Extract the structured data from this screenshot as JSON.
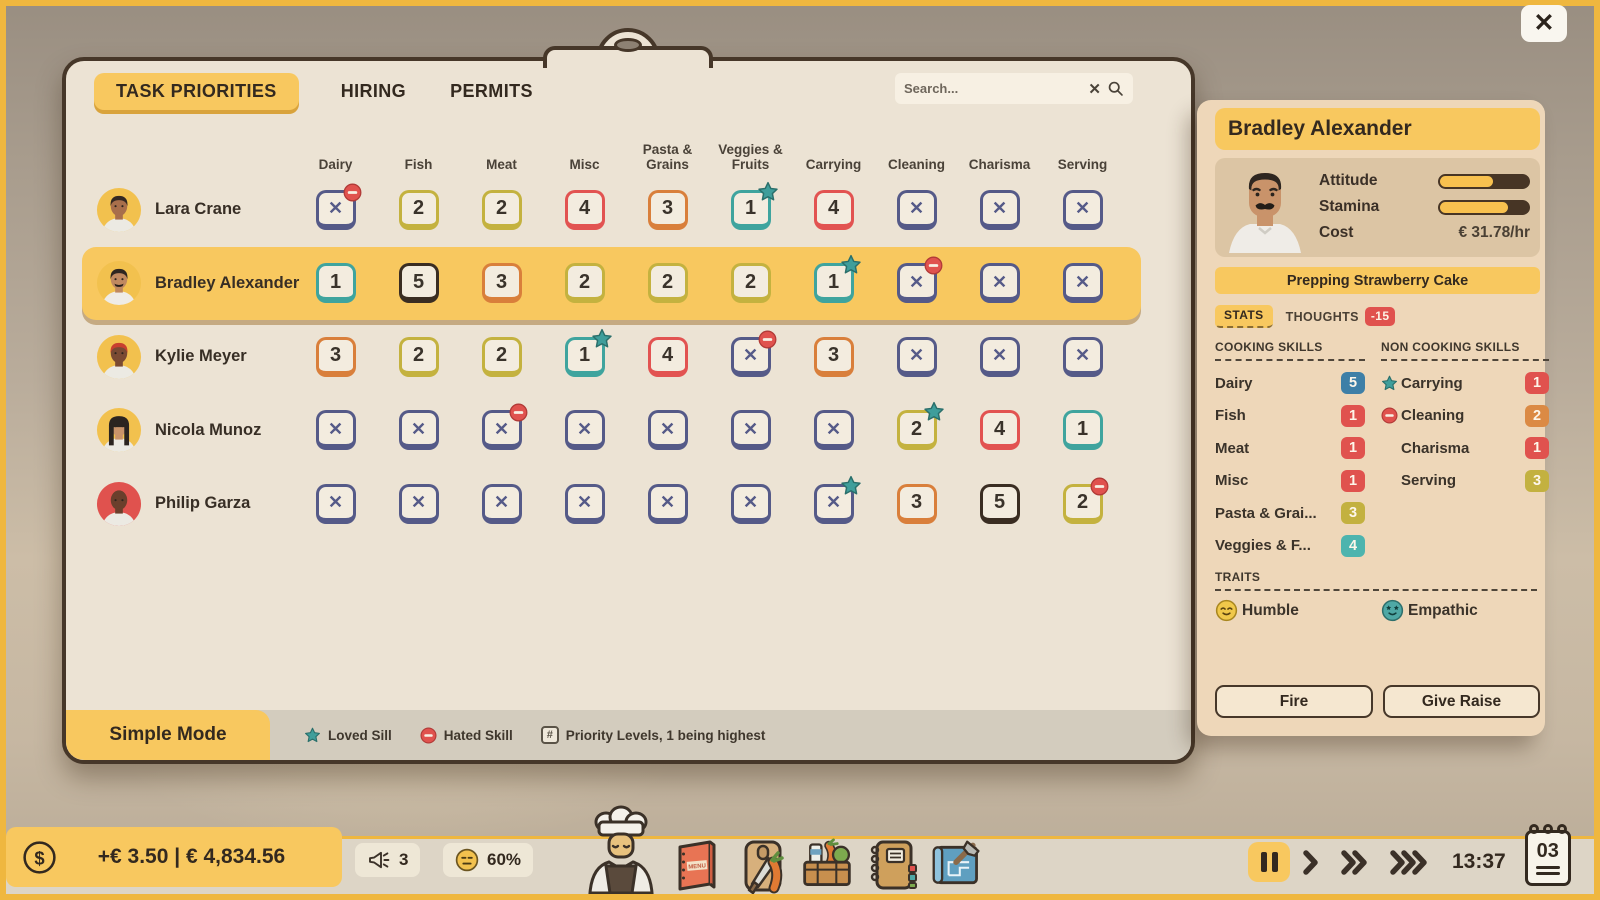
{
  "colors": {
    "accent_yellow": "#f8c85f",
    "panel_bg": "#ece3d4",
    "panel_border": "#463729",
    "detail_bg": "#eed7b9",
    "hud_bg": "#ddd5c6",
    "frame": "#efb73f",
    "loved_teal": "#3f9e9b",
    "hated_red": "#e0524e"
  },
  "window": {
    "close_icon": "✕"
  },
  "tabs": [
    {
      "label": "TASK PRIORITIES",
      "active": true
    },
    {
      "label": "HIRING",
      "active": false
    },
    {
      "label": "PERMITS",
      "active": false
    }
  ],
  "search": {
    "placeholder": "Search...",
    "clear_icon": "✕"
  },
  "table": {
    "columns": [
      "Dairy",
      "Fish",
      "Meat",
      "Misc",
      "Pasta & Grains",
      "Veggies & Fruits",
      "Carrying",
      "Cleaning",
      "Charisma",
      "Serving"
    ],
    "priority_colors": {
      "x": "#555a88",
      "1": "#3fa49e",
      "2": "#c4b23f",
      "3": "#d97f3b",
      "4": "#e25351",
      "5": "#3a2d22"
    },
    "staff": [
      {
        "name": "Lara Crane",
        "selected": false,
        "avatar": {
          "bg": "#f2c14e",
          "skin": "#a86f4b",
          "hair": "#332822",
          "shirt": "#eceae3",
          "long": false,
          "moustache": false
        },
        "cells": [
          {
            "v": "x",
            "hated": true
          },
          {
            "v": "2"
          },
          {
            "v": "2"
          },
          {
            "v": "4"
          },
          {
            "v": "3"
          },
          {
            "v": "1",
            "loved": true
          },
          {
            "v": "4"
          },
          {
            "v": "x"
          },
          {
            "v": "x"
          },
          {
            "v": "x"
          }
        ]
      },
      {
        "name": "Bradley Alexander",
        "selected": true,
        "avatar": {
          "bg": "#f2c14e",
          "skin": "#c08960",
          "hair": "#2e2620",
          "shirt": "#efece7",
          "long": false,
          "moustache": true
        },
        "cells": [
          {
            "v": "1"
          },
          {
            "v": "5"
          },
          {
            "v": "3"
          },
          {
            "v": "2"
          },
          {
            "v": "2"
          },
          {
            "v": "2"
          },
          {
            "v": "1",
            "loved": true
          },
          {
            "v": "x",
            "hated": true
          },
          {
            "v": "x"
          },
          {
            "v": "x"
          }
        ]
      },
      {
        "name": "Kylie Meyer",
        "selected": false,
        "avatar": {
          "bg": "#f2c14e",
          "skin": "#7a4a33",
          "hair": "#c8402f",
          "shirt": "#eceae3",
          "long": false,
          "moustache": false
        },
        "cells": [
          {
            "v": "3"
          },
          {
            "v": "2"
          },
          {
            "v": "2"
          },
          {
            "v": "1",
            "loved": true
          },
          {
            "v": "4"
          },
          {
            "v": "x",
            "hated": true
          },
          {
            "v": "3"
          },
          {
            "v": "x"
          },
          {
            "v": "x"
          },
          {
            "v": "x"
          }
        ]
      },
      {
        "name": "Nicola Munoz",
        "selected": false,
        "avatar": {
          "bg": "#f2c14e",
          "skin": "#c9936a",
          "hair": "#2b2420",
          "shirt": "#eceae3",
          "long": true,
          "moustache": false
        },
        "cells": [
          {
            "v": "x"
          },
          {
            "v": "x"
          },
          {
            "v": "x",
            "hated": true
          },
          {
            "v": "x"
          },
          {
            "v": "x"
          },
          {
            "v": "x"
          },
          {
            "v": "x"
          },
          {
            "v": "2",
            "loved": true
          },
          {
            "v": "4"
          },
          {
            "v": "1"
          }
        ]
      },
      {
        "name": "Philip Garza",
        "selected": false,
        "avatar": {
          "bg": "#e0524e",
          "skin": "#6b3f2c",
          "hair": "",
          "shirt": "#eceae3",
          "long": false,
          "moustache": false
        },
        "cells": [
          {
            "v": "x"
          },
          {
            "v": "x"
          },
          {
            "v": "x"
          },
          {
            "v": "x"
          },
          {
            "v": "x"
          },
          {
            "v": "x"
          },
          {
            "v": "x",
            "loved": true
          },
          {
            "v": "3"
          },
          {
            "v": "5"
          },
          {
            "v": "2",
            "hated": true
          }
        ]
      }
    ]
  },
  "footer": {
    "mode_label": "Simple Mode",
    "legend": [
      {
        "icon": "loved-star-icon",
        "label": "Loved Sill"
      },
      {
        "icon": "hated-minus-icon",
        "label": "Hated Skill"
      },
      {
        "icon": "priority-hash-icon",
        "hash": "#",
        "label": "Priority Levels, 1 being highest"
      }
    ]
  },
  "detail": {
    "name": "Bradley Alexander",
    "attitude_label": "Attitude",
    "attitude_pct": 62,
    "stamina_label": "Stamina",
    "stamina_pct": 78,
    "cost_label": "Cost",
    "cost_value": "€ 31.78/hr",
    "activity": "Prepping Strawberry Cake",
    "tabs": {
      "stats": "STATS",
      "thoughts": "THOUGHTS",
      "thoughts_badge": "-15"
    },
    "cooking_header": "COOKING SKILLS",
    "noncooking_header": "NON COOKING SKILLS",
    "badge_colors": {
      "1": "#e0524e",
      "2": "#db8a44",
      "3": "#c3b140",
      "4": "#4db4ae",
      "5": "#3e7fa7"
    },
    "cooking_skills": [
      {
        "label": "Dairy",
        "value": "5"
      },
      {
        "label": "Fish",
        "value": "1"
      },
      {
        "label": "Meat",
        "value": "1"
      },
      {
        "label": "Misc",
        "value": "1"
      },
      {
        "label": "Pasta & Grai...",
        "value": "3"
      },
      {
        "label": "Veggies & F...",
        "value": "4"
      }
    ],
    "noncooking_skills": [
      {
        "label": "Carrying",
        "value": "1",
        "icon": "loved"
      },
      {
        "label": "Cleaning",
        "value": "2",
        "icon": "hated"
      },
      {
        "label": "Charisma",
        "value": "1",
        "icon": ""
      },
      {
        "label": "Serving",
        "value": "3",
        "icon": ""
      }
    ],
    "traits_header": "TRAITS",
    "traits": [
      {
        "label": "Humble",
        "emoji": "humble"
      },
      {
        "label": "Empathic",
        "emoji": "empathic"
      }
    ],
    "fire_label": "Fire",
    "raise_label": "Give Raise",
    "portrait": {
      "skin": "#c9936a",
      "hair": "#2e2620",
      "shirt": "#efece7",
      "moustache": true
    }
  },
  "hud": {
    "money": "+€ 3.50 | € 4,834.56",
    "marketing_count": "3",
    "mood_pct": "60%",
    "toolbar": [
      {
        "name": "staff-button",
        "icon": "chef"
      },
      {
        "name": "menu-button",
        "icon": "menu"
      },
      {
        "name": "prep-button",
        "icon": "prep"
      },
      {
        "name": "supplies-button",
        "icon": "supplies"
      },
      {
        "name": "ledger-button",
        "icon": "ledger"
      },
      {
        "name": "build-button",
        "icon": "build"
      }
    ],
    "speed_controls": [
      {
        "name": "pause-button",
        "active": true
      },
      {
        "name": "play-button",
        "chevrons": 1
      },
      {
        "name": "fast-forward-button",
        "chevrons": 2
      },
      {
        "name": "fastest-forward-button",
        "chevrons": 3
      }
    ],
    "time": "13:37",
    "date": "03"
  }
}
